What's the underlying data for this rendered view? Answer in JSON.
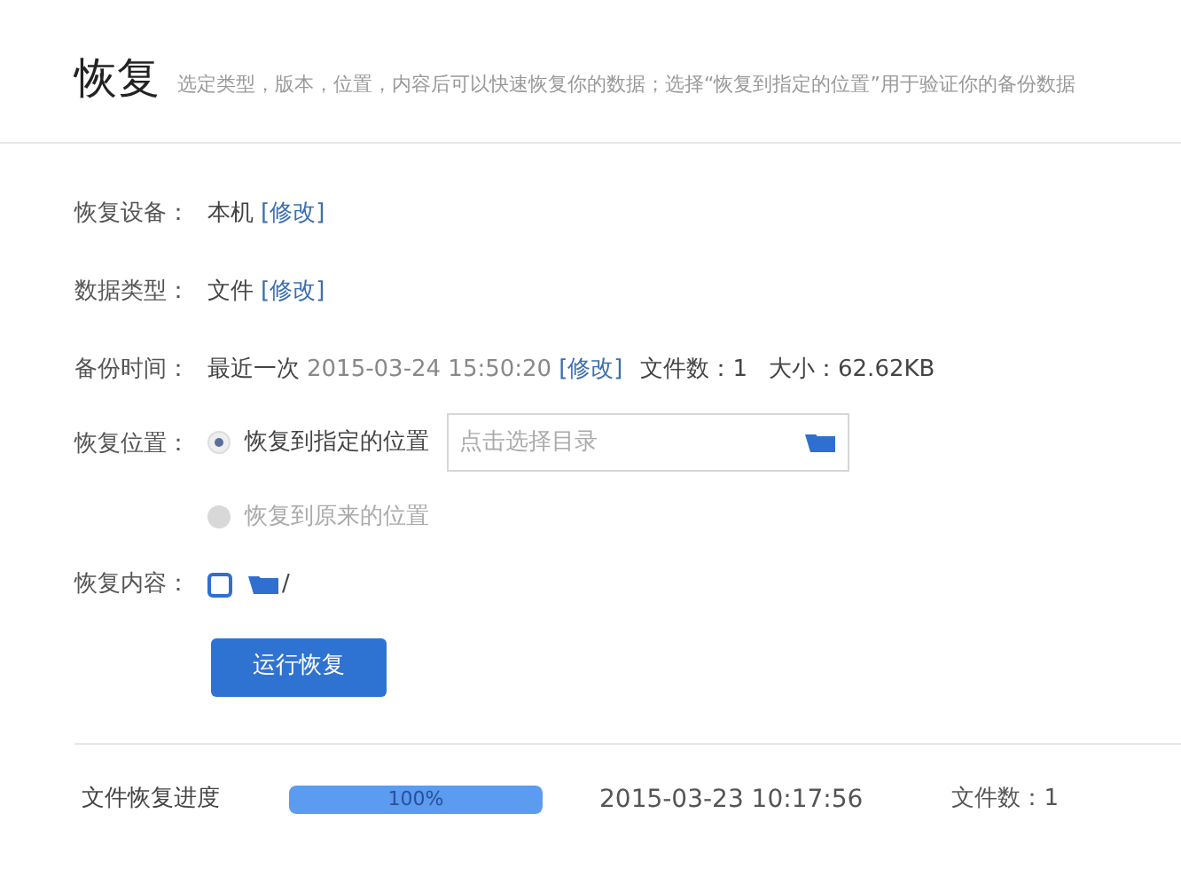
{
  "header": {
    "title": "恢复",
    "description": "选定类型，版本，位置，内容后可以快速恢复你的数据；选择“恢复到指定的位置”用于验证你的备份数据"
  },
  "device": {
    "label": "恢复设备：",
    "value": "本机",
    "link": "[修改]"
  },
  "data_type": {
    "label": "数据类型：",
    "value": "文件",
    "link": "[修改]"
  },
  "backup_time": {
    "label": "备份时间：",
    "prefix": "最近一次",
    "time": "2015-03-24 15:50:20",
    "link": "[修改]",
    "file_count": "文件数：1",
    "size": "大小：62.62KB"
  },
  "location": {
    "label": "恢复位置：",
    "options": [
      {
        "label": "恢复到指定的位置",
        "selected": true
      },
      {
        "label": "恢复到原来的位置",
        "selected": false
      }
    ],
    "directory": {
      "placeholder": "点击选择目录"
    }
  },
  "content": {
    "label": "恢复内容：",
    "checked": false,
    "path": "/"
  },
  "run_button": "运行恢复",
  "progress": {
    "label": "文件恢复进度",
    "level": 1,
    "percent": "100%",
    "time": "2015-03-23 10:17:56",
    "file_count": "文件数：1"
  }
}
